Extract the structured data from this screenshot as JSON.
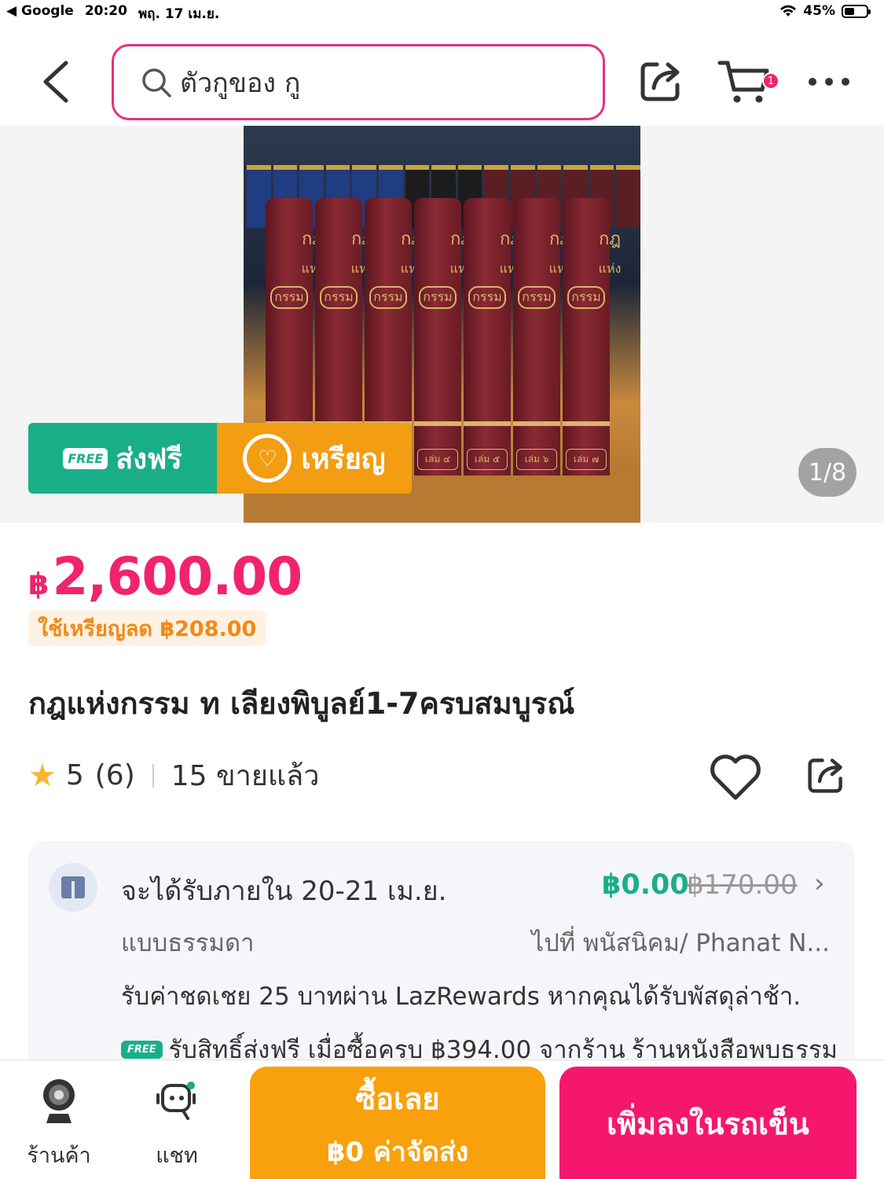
{
  "status_bar": {
    "back_app": "◀ Google",
    "time": "20:20",
    "date": "พฤ. 17 เม.ย.",
    "battery": "45%"
  },
  "header": {
    "search_query": "ตัวกูของ กู",
    "cart_count": "1"
  },
  "gallery": {
    "counter": "1/8",
    "promo_free_badge": "FREE",
    "promo_free_label": "ส่งฟรี",
    "promo_coin_label": "เหรียญ",
    "book_titles": [
      "กฎ",
      "แห่ง",
      "กรรม"
    ],
    "volume_labels": [
      "",
      "",
      "",
      "เล่ม ๔",
      "เล่ม ๕",
      "เล่ม ๖",
      "เล่ม ๗"
    ]
  },
  "product": {
    "currency": "฿",
    "price": "2,600.00",
    "coin_discount": "ใช้เหรียญลด ฿208.00",
    "title": "กฎแห่งกรรม ท เลียงพิบูลย์1-7ครบสมบูรณ์",
    "rating": "5",
    "rating_count": "(6)",
    "sold": "15 ขายแล้ว"
  },
  "delivery": {
    "date": "จะได้รับภายใน 20-21 เม.ย.",
    "fee": "฿0.00",
    "old_fee": "฿170.00",
    "type": "แบบธรรมดา",
    "address": "ไปที่ พนัสนิคม/ Phanat N...",
    "compensation": "รับค่าชดเชย 25 บาทผ่าน LazRewards หากคุณได้รับพัสดุล่าช้า.",
    "promo_badge": "FREE",
    "promo_text": "รับสิทธิ์ส่งฟรี เมื่อซื้อครบ ฿394.00 จากร้าน",
    "shop_name": "ร้านหนังสือพบธรรม"
  },
  "bottom_bar": {
    "shop_label": "ร้านค้า",
    "chat_label": "แชท",
    "buy_now": "ซื้อเลย",
    "buy_now_sub": "฿0 ค่าจัดส่ง",
    "add_to_cart": "เพิ่มลงในรถเข็น"
  },
  "colors": {
    "brand_pink": "#f0246c",
    "free_green": "#1aae88",
    "coin_orange": "#f29d12",
    "buy_orange": "#f9a10c"
  },
  "icons": [
    "chevron-left-icon",
    "search-icon",
    "share-icon",
    "cart-icon",
    "more-icon",
    "star-icon",
    "heart-icon",
    "delivery-box-icon",
    "chevron-right-icon",
    "shop-icon",
    "chat-icon",
    "wifi-icon",
    "battery-icon"
  ]
}
